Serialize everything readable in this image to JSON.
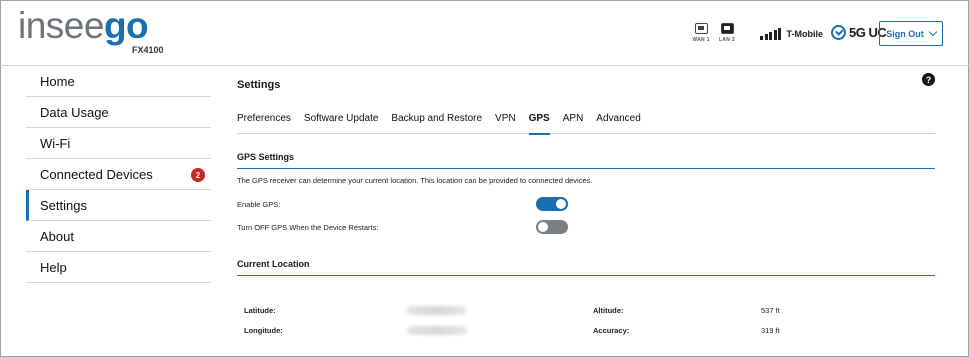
{
  "brand": {
    "logo_part1": "insee",
    "logo_part2": "go",
    "model": "FX4100"
  },
  "status": {
    "wan_label": "WAN 1",
    "lan_label": "LAN 2",
    "carrier": "T-Mobile",
    "network_type": "5G UC"
  },
  "header": {
    "sign_out_label": "Sign Out"
  },
  "sidebar": {
    "items": [
      {
        "label": "Home"
      },
      {
        "label": "Data Usage"
      },
      {
        "label": "Wi-Fi"
      },
      {
        "label": "Connected Devices",
        "badge": "2"
      },
      {
        "label": "Settings",
        "active": true
      },
      {
        "label": "About"
      },
      {
        "label": "Help"
      }
    ]
  },
  "main": {
    "title": "Settings",
    "help_label": "?",
    "tabs": [
      {
        "label": "Preferences"
      },
      {
        "label": "Software Update"
      },
      {
        "label": "Backup and Restore"
      },
      {
        "label": "VPN"
      },
      {
        "label": "GPS",
        "active": true
      },
      {
        "label": "APN"
      },
      {
        "label": "Advanced"
      }
    ],
    "gps_settings": {
      "title": "GPS Settings",
      "description": "The GPS receiver can determine your current location. This location can be provided to connected devices.",
      "enable_label": "Enable GPS:",
      "enable_value": true,
      "turn_off_label": "Turn OFF GPS When the Device Restarts:",
      "turn_off_value": false
    },
    "current_location": {
      "title": "Current Location",
      "latitude_label": "Latitude:",
      "longitude_label": "Longitude:",
      "altitude_label": "Altitude:",
      "altitude_value": "537 ft",
      "accuracy_label": "Accuracy:",
      "accuracy_value": "319 ft"
    }
  },
  "colors": {
    "accent": "#1a6fb0",
    "badge": "#c62828",
    "toggle_off": "#7a7f84"
  }
}
